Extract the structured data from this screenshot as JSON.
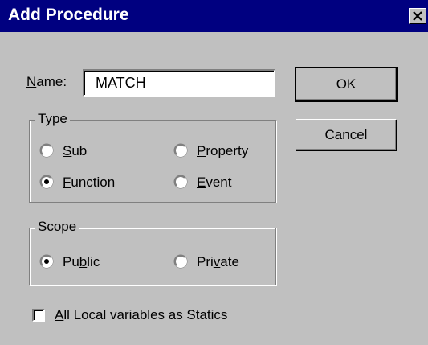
{
  "dialog": {
    "title": "Add Procedure",
    "close_icon": "close-icon"
  },
  "name": {
    "label_mnemonic": "N",
    "label_rest": "ame:",
    "value": "MATCH"
  },
  "type_group": {
    "title": "Type",
    "options": [
      {
        "mnemonic": "S",
        "rest": "ub",
        "checked": false
      },
      {
        "mnemonic": "P",
        "rest": "roperty",
        "checked": false
      },
      {
        "mnemonic": "F",
        "rest": "unction",
        "checked": true
      },
      {
        "mnemonic": "E",
        "rest": "vent",
        "checked": false
      }
    ]
  },
  "scope_group": {
    "title": "Scope",
    "public": {
      "pre": "Pu",
      "mnemonic": "b",
      "post": "lic",
      "checked": true
    },
    "private": {
      "pre": "Pri",
      "mnemonic": "v",
      "post": "ate",
      "checked": false
    }
  },
  "statics": {
    "mnemonic": "A",
    "rest": "ll Local variables as Statics",
    "checked": false
  },
  "buttons": {
    "ok_label": "OK",
    "cancel_label": "Cancel"
  },
  "colors": {
    "titlebar": "#000080",
    "face": "#c0c0c0"
  }
}
